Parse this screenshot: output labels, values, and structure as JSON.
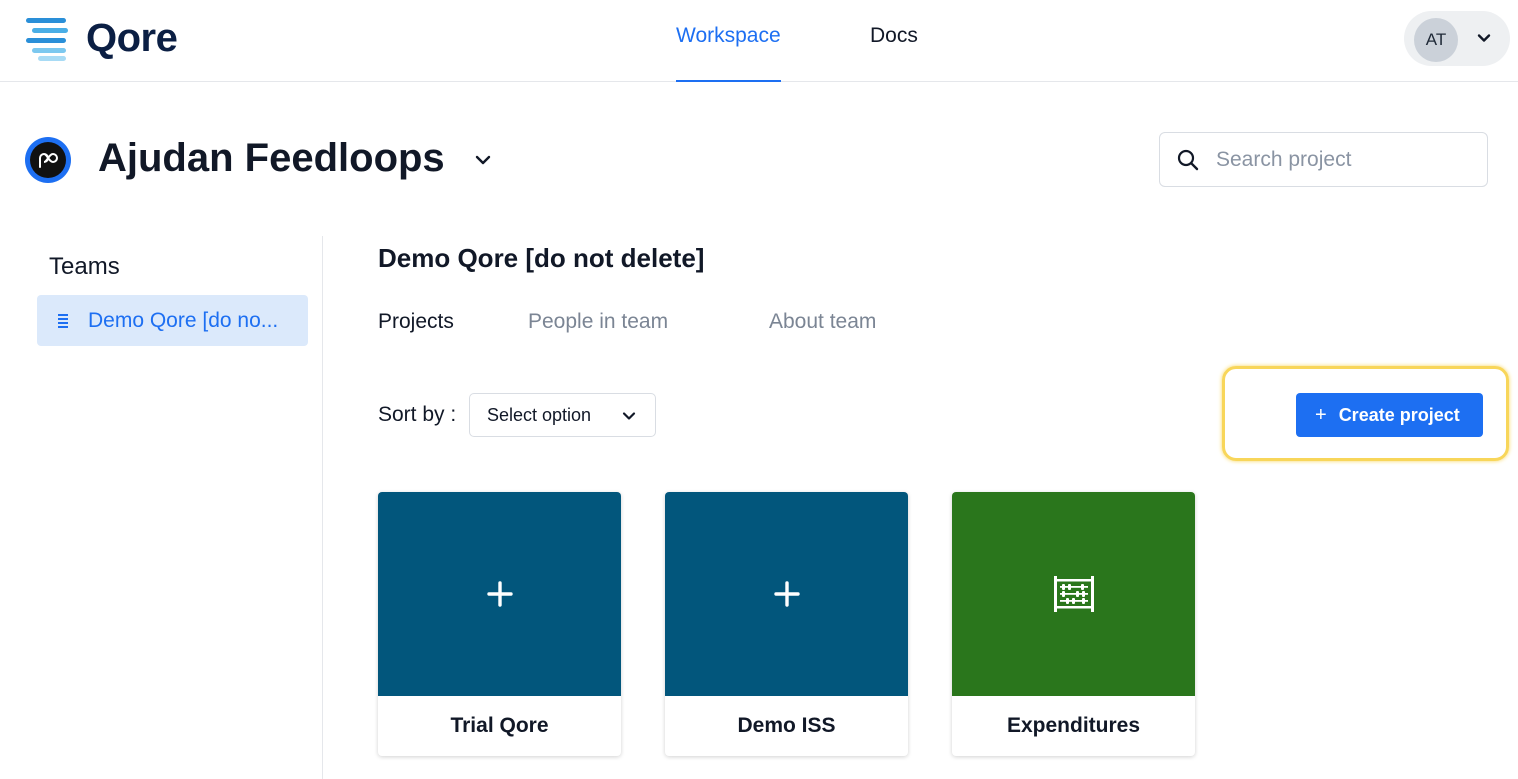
{
  "app": {
    "name": "Qore"
  },
  "nav": {
    "tabs": [
      {
        "label": "Workspace",
        "active": true
      },
      {
        "label": "Docs",
        "active": false
      }
    ]
  },
  "user": {
    "initials": "AT"
  },
  "org": {
    "name": "Ajudan Feedloops"
  },
  "search": {
    "placeholder": "Search project",
    "value": ""
  },
  "sidebar": {
    "title": "Teams",
    "items": [
      {
        "label": "Demo Qore [do no...",
        "selected": true
      }
    ]
  },
  "team": {
    "title": "Demo Qore [do not delete]",
    "tabs": [
      {
        "label": "Projects",
        "active": true
      },
      {
        "label": "People in team",
        "active": false
      },
      {
        "label": "About team",
        "active": false
      }
    ]
  },
  "toolbar": {
    "sort_label": "Sort by :",
    "sort_value": "Select option",
    "create_plus": "+",
    "create_label": "Create project"
  },
  "projects": [
    {
      "name": "Trial Qore",
      "icon": "plus-icon",
      "color": "#02567c"
    },
    {
      "name": "Demo ISS",
      "icon": "plus-icon",
      "color": "#02567c"
    },
    {
      "name": "Expenditures",
      "icon": "abacus-icon",
      "color": "#2a761c"
    }
  ],
  "colors": {
    "accent": "#1d6ff2",
    "highlight": "#f8d65a"
  }
}
